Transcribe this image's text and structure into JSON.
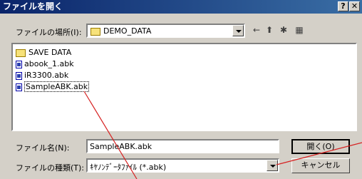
{
  "window": {
    "title": "ファイルを開く",
    "help_glyph": "?",
    "close_glyph": "✕"
  },
  "location": {
    "label": "ファイルの場所(I):",
    "value": "DEMO_DATA"
  },
  "files": [
    {
      "name": "SAVE DATA",
      "type": "folder"
    },
    {
      "name": "abook_1.abk",
      "type": "file"
    },
    {
      "name": "iR3300.abk",
      "type": "file"
    },
    {
      "name": "SampleABK.abk",
      "type": "file"
    }
  ],
  "filename": {
    "label": "ファイル名(N):",
    "value": "SampleABK.abk"
  },
  "filetype": {
    "label": "ファイルの種類(T):",
    "value": "ｷﾔﾉﾝﾃﾞｰﾀﾌｧｲﾙ (*.abk)"
  },
  "buttons": {
    "open": "開く(O)",
    "cancel": "キャンセル"
  },
  "toolbar": {
    "back": "←",
    "up": "⬆",
    "new_folder": "✱",
    "view": "▦"
  }
}
